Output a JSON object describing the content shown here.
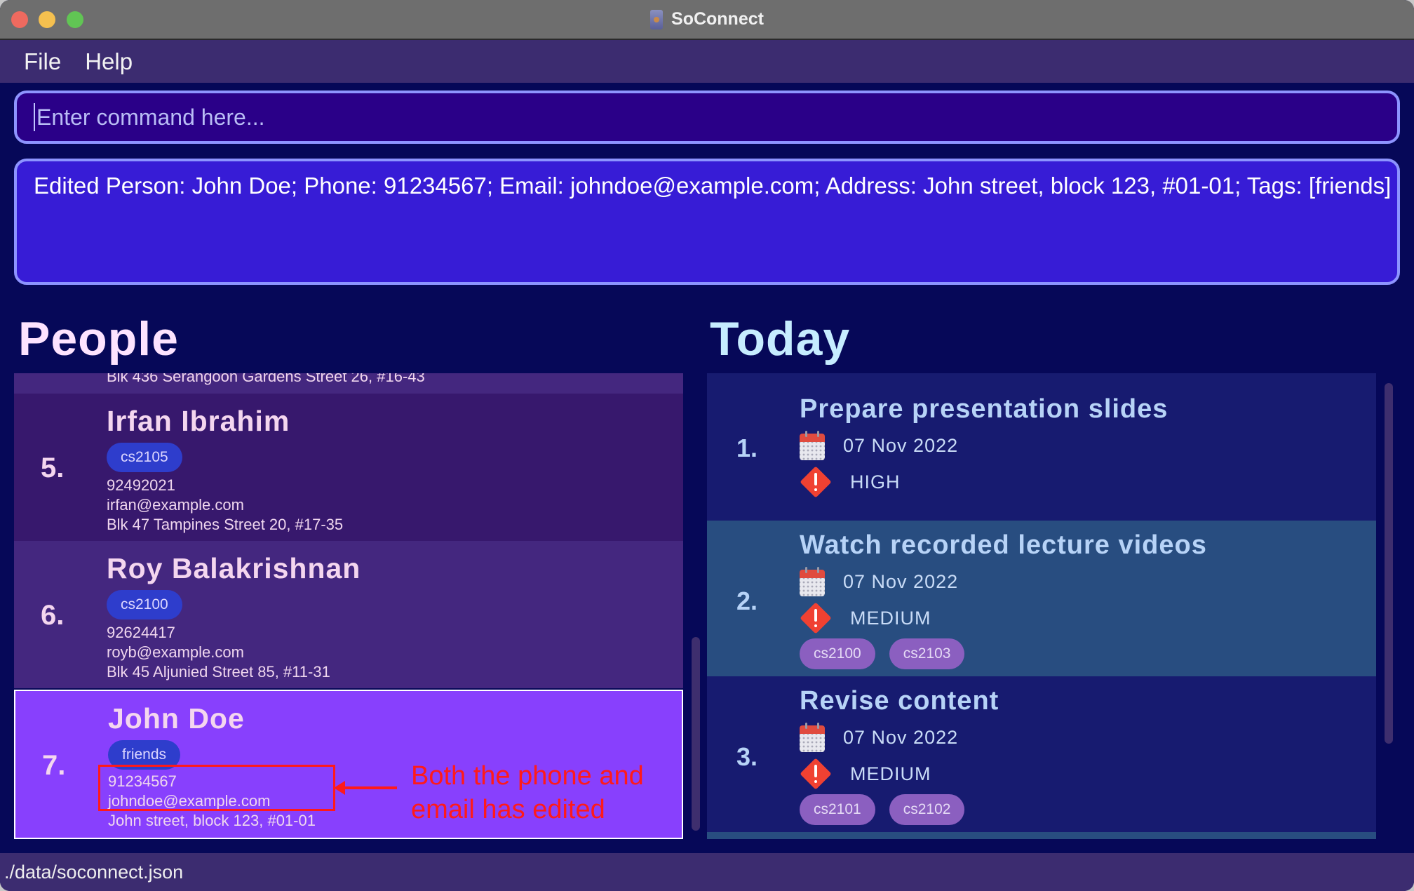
{
  "window": {
    "title": "SoConnect"
  },
  "menu": {
    "items": [
      "File",
      "Help"
    ]
  },
  "command": {
    "placeholder": "Enter command here...",
    "value": ""
  },
  "result": {
    "text": "Edited Person: John Doe; Phone: 91234567; Email: johndoe@example.com; Address: John street, block 123, #01-01; Tags: [friends]"
  },
  "people": {
    "heading": "People",
    "partial_previous": {
      "address": "Blk 436 Serangoon Gardens Street 26, #16-43"
    },
    "items": [
      {
        "index": "5.",
        "name": "Irfan Ibrahim",
        "tags": [
          "cs2105"
        ],
        "phone": "92492021",
        "email": "irfan@example.com",
        "address": "Blk 47 Tampines Street 20, #17-35"
      },
      {
        "index": "6.",
        "name": "Roy Balakrishnan",
        "tags": [
          "cs2100"
        ],
        "phone": "92624417",
        "email": "royb@example.com",
        "address": "Blk 45 Aljunied Street 85, #11-31"
      },
      {
        "index": "7.",
        "name": "John Doe",
        "tags": [
          "friends"
        ],
        "phone": "91234567",
        "email": "johndoe@example.com",
        "address": "John street, block 123, #01-01",
        "selected": true
      }
    ]
  },
  "annotation": {
    "line1": "Both the phone and",
    "line2": "email has edited",
    "color": "#ff1a1a"
  },
  "today": {
    "heading": "Today",
    "items": [
      {
        "index": "1.",
        "title": "Prepare presentation slides",
        "date": "07 Nov 2022",
        "priority": "HIGH",
        "tags": []
      },
      {
        "index": "2.",
        "title": "Watch recorded lecture videos",
        "date": "07 Nov 2022",
        "priority": "MEDIUM",
        "tags": [
          "cs2100",
          "cs2103"
        ]
      },
      {
        "index": "3.",
        "title": "Revise content",
        "date": "07 Nov 2022",
        "priority": "MEDIUM",
        "tags": [
          "cs2101",
          "cs2102"
        ]
      }
    ]
  },
  "status": {
    "path": "./data/soconnect.json"
  },
  "colors": {
    "selected_card": "#8840fd",
    "person_tag": "#2e3dcc",
    "task_tag": "#8b5fc0",
    "priority_icon": "#f04132"
  }
}
